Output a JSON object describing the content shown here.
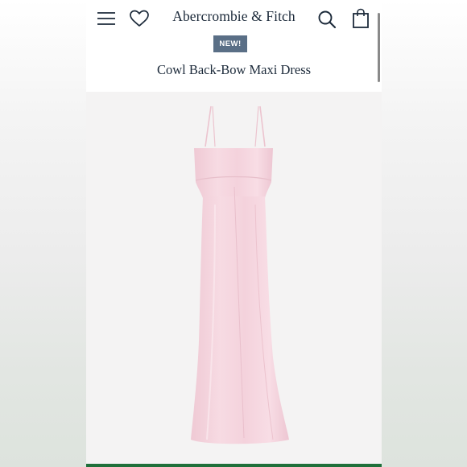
{
  "header": {
    "brand": "Abercrombie & Fitch",
    "icons": {
      "menu": "hamburger-menu-icon",
      "wishlist": "heart-icon",
      "search": "search-icon",
      "bag": "shopping-bag-icon"
    }
  },
  "product": {
    "badge": "NEW!",
    "title": "Cowl Back-Bow Maxi Dress",
    "image": "pink-satin-maxi-dress"
  },
  "colors": {
    "brand_navy": "#1c2a3a",
    "badge_bg": "#5a6f86",
    "dress_pink": "#f2cdd8",
    "bottom_bar": "#1f6f3a"
  }
}
